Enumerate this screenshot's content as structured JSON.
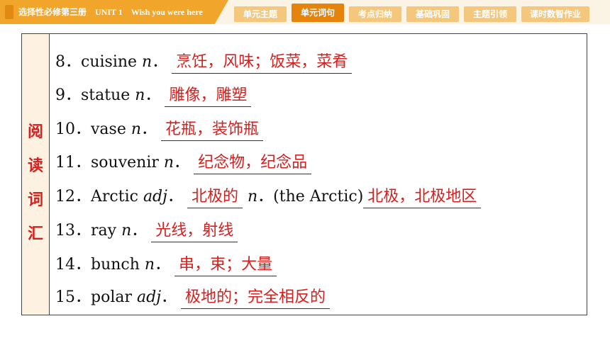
{
  "header": {
    "course": "选择性必修第三册　UNIT 1　Wish you were here",
    "tabs": [
      {
        "label": "单元主题",
        "active": false
      },
      {
        "label": "单元词句",
        "active": true
      },
      {
        "label": "考点归纳",
        "active": false
      },
      {
        "label": "基础巩固",
        "active": false
      },
      {
        "label": "主题引领",
        "active": false
      },
      {
        "label": "课时数智作业",
        "active": false
      }
    ]
  },
  "side_label": [
    "阅",
    "读",
    "词",
    "汇"
  ],
  "rows": [
    {
      "num": "8．",
      "word": "cuisine",
      "pos": "n",
      "dot": "．",
      "answer": "烹饪，风味；饭菜，菜肴"
    },
    {
      "num": "9．",
      "word": "statue",
      "pos": "n",
      "dot": "．",
      "answer": "雕像，雕塑"
    },
    {
      "num": "10．",
      "word": "vase",
      "pos": "n",
      "dot": "．",
      "answer": "花瓶，装饰瓶"
    },
    {
      "num": "11．",
      "word": "souvenir",
      "pos": "n",
      "dot": "．",
      "answer": "纪念物，纪念品"
    },
    {
      "num": "12．",
      "word": "Arctic",
      "pos": "adj",
      "dot": "．",
      "answer": "北极的",
      "pos2": "n",
      "extra": "．(the Arctic)",
      "answer2": "北极，北极地区"
    },
    {
      "num": "13．",
      "word": "ray",
      "pos": "n",
      "dot": "．",
      "answer": "光线，射线"
    },
    {
      "num": "14．",
      "word": "bunch",
      "pos": "n",
      "dot": "．",
      "answer": "串，束；大量"
    },
    {
      "num": "15．",
      "word": "polar",
      "pos": "adj",
      "dot": "．",
      "answer": "极地的；完全相反的"
    }
  ],
  "colors": {
    "accent": "#f2a52b",
    "active_tab": "#e5830b",
    "answer": "#d6201f"
  }
}
